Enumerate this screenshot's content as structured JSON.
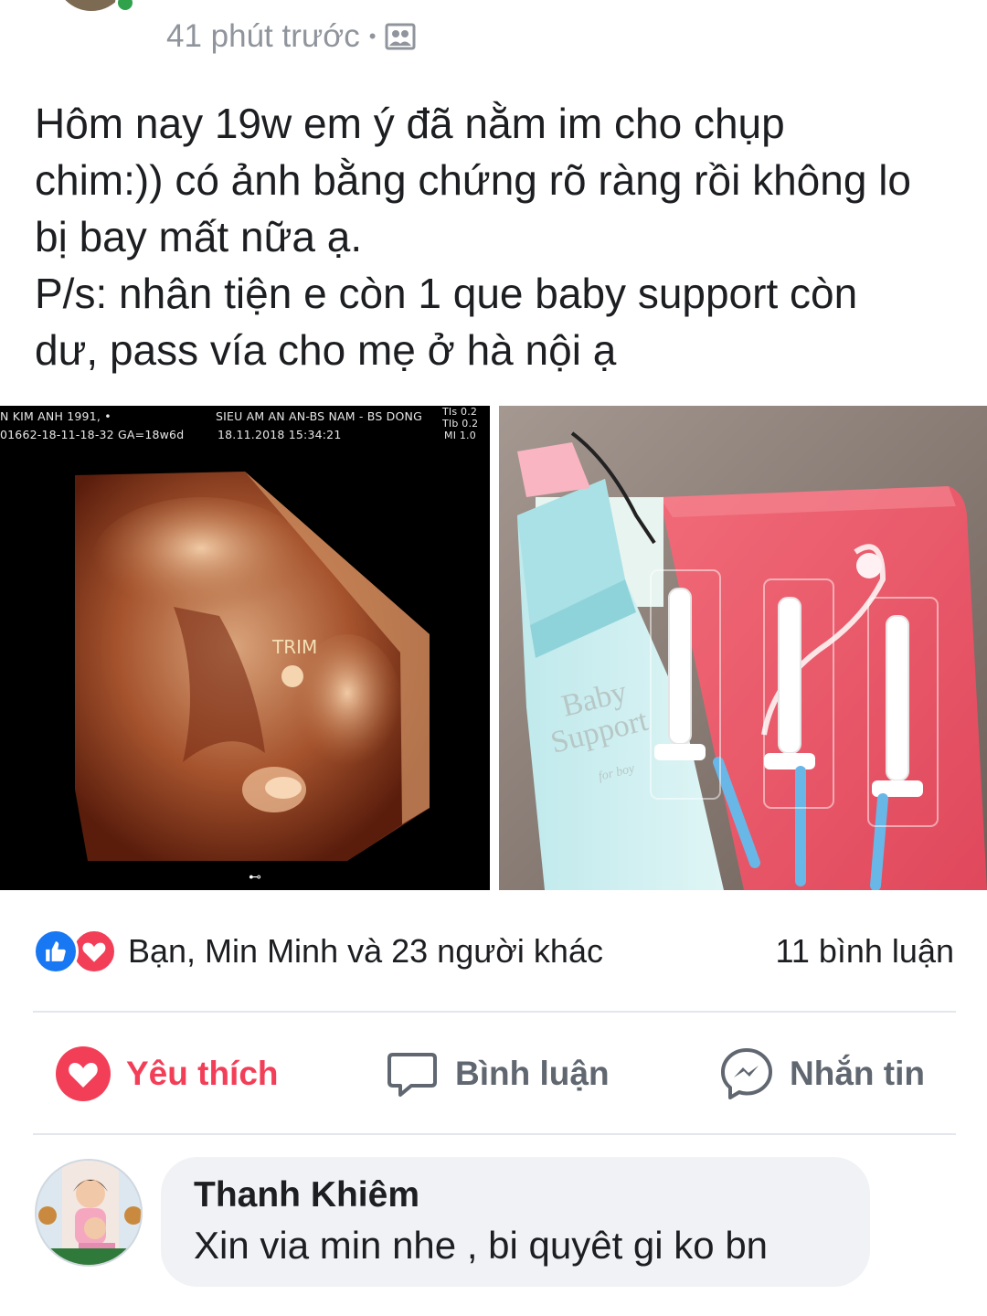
{
  "post": {
    "time": "41 phút trước",
    "separator": "•",
    "privacy_icon": "group-privacy-icon",
    "text_lines": [
      "Hôm nay 19w em ý đã nằm im cho chụp",
      "chim:)) có ảnh bằng chứng rõ ràng rồi không lo",
      "bị bay mất nữa ạ.",
      "P/s: nhân tiện e còn 1 que baby support còn",
      "dư, pass vía cho mẹ ở hà nội ạ"
    ]
  },
  "ultrasound": {
    "patient": "N KIM ANH 1991,  •",
    "id_line": "01662-18-11-18-32  GA=18w6d",
    "clinic": "SIEU AM AN AN-BS NAM - BS DONG",
    "datetime": "18.11.2018      15:34:21",
    "tis": "TIs  0.2",
    "tib": "TIb  0.2",
    "mi": "MI  1.0",
    "trim_label": "TRIM"
  },
  "product_photo": {
    "brand_line1": "Baby",
    "brand_line2": "Support",
    "brand_line3": "for boy"
  },
  "reactions": {
    "summary": "Bạn, Min Minh và 23 người khác",
    "comments": "11 bình luận",
    "colors": {
      "like": "#1877f2",
      "love": "#f33e58"
    }
  },
  "actions": {
    "like_label": "Yêu thích",
    "comment_label": "Bình luận",
    "message_label": "Nhắn tin"
  },
  "comment": {
    "author": "Thanh Khiêm",
    "text": "Xin via min nhe , bi quyêt gi ko bn"
  }
}
